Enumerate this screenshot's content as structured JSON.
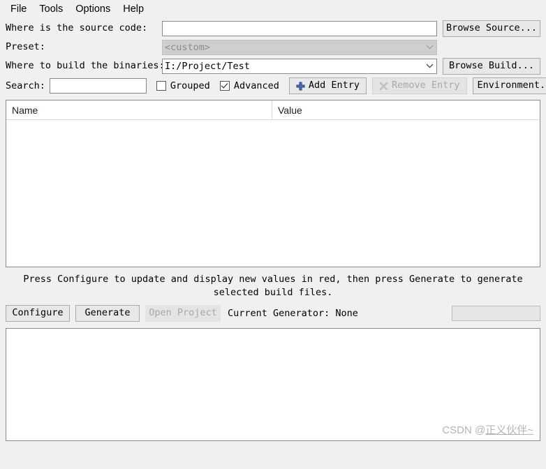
{
  "menubar": {
    "items": [
      {
        "label": "File"
      },
      {
        "label": "Tools"
      },
      {
        "label": "Options"
      },
      {
        "label": "Help"
      }
    ]
  },
  "form": {
    "source": {
      "label": "Where is the source code:",
      "value": "",
      "placeholder": "",
      "browse_button": "Browse Source..."
    },
    "preset": {
      "label": "Preset:",
      "value": "<custom>",
      "disabled": true
    },
    "binaries": {
      "label": "Where to build the binaries:",
      "value": "I:/Project/Test",
      "browse_button": "Browse Build..."
    }
  },
  "toolbar": {
    "search_label": "Search:",
    "search_value": "",
    "search_placeholder": "",
    "grouped_label": "Grouped",
    "grouped_checked": false,
    "advanced_label": "Advanced",
    "advanced_checked": true,
    "add_entry_label": "Add Entry",
    "add_entry_icon": "plus-icon",
    "remove_entry_label": "Remove Entry",
    "remove_entry_icon": "cross-icon",
    "remove_entry_disabled": true,
    "environment_label": "Environment..."
  },
  "table": {
    "columns": [
      "Name",
      "Value"
    ],
    "rows": []
  },
  "status": {
    "message": "Press Configure to update and display new values in red, then press Generate to generate selected build files."
  },
  "actions": {
    "configure_label": "Configure",
    "generate_label": "Generate",
    "open_project_label": "Open Project",
    "open_project_disabled": true,
    "generator_label": "Current Generator: None",
    "progress_value": 0
  },
  "output": {
    "text": ""
  },
  "watermark": {
    "prefix": "CSDN @",
    "name": "正义伙伴~"
  },
  "colors": {
    "window_bg": "#f0f0f0",
    "field_bg": "#ffffff",
    "border": "#898989",
    "disabled_text": "#8a8a8a",
    "accent_icon": "#3b5faa",
    "watermark": "#b4b4b4"
  }
}
